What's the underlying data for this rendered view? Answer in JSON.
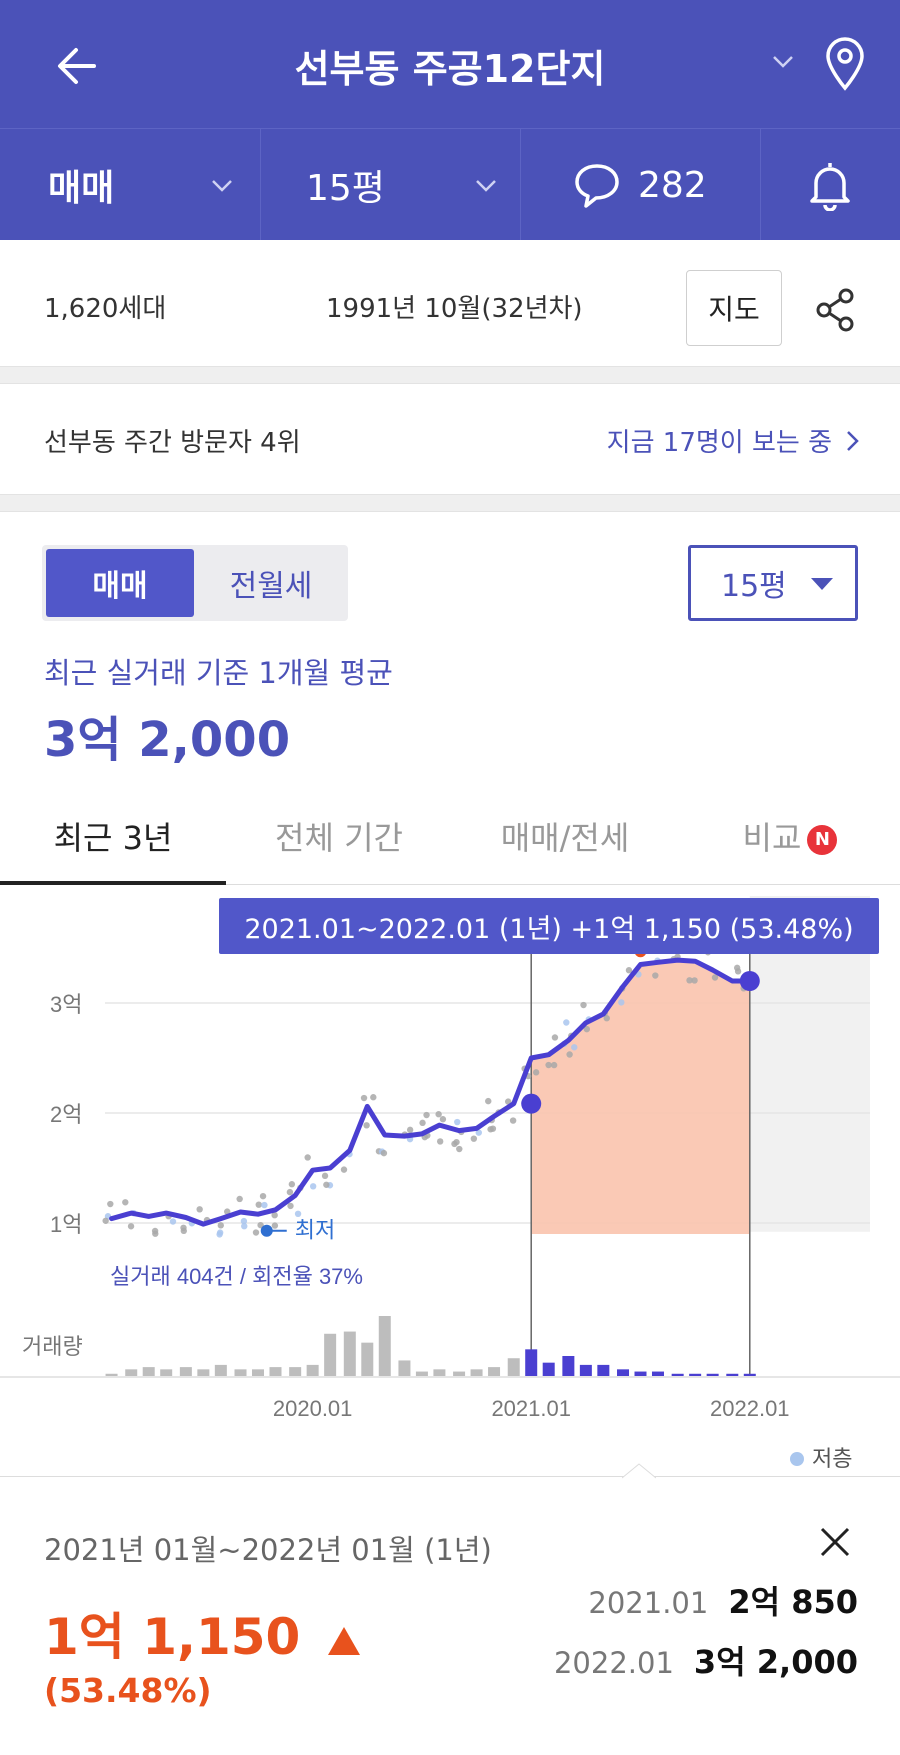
{
  "header": {
    "title": "선부동 주공12단지"
  },
  "subbar": {
    "trade_type": "매매",
    "size": "15평",
    "comment_count": "282"
  },
  "info": {
    "households": "1,620세대",
    "built": "1991년 10월(32년차)",
    "map_label": "지도"
  },
  "rank": {
    "left_text": "선부동 주간 방문자 4위",
    "right_text": "지금 17명이 보는 중"
  },
  "filter": {
    "segment_on": "매매",
    "segment_off": "전월세",
    "size": "15평"
  },
  "summary": {
    "label": "최근 실거래 기준 1개월 평균",
    "price": "3억 2,000"
  },
  "tabs": [
    {
      "label": "최근 3년"
    },
    {
      "label": "전체 기간"
    },
    {
      "label": "매매/전세"
    },
    {
      "label": "비교"
    }
  ],
  "tab_badge": "N",
  "colors": {
    "brand": "#4b52b8",
    "accent_line": "#4a3fd1",
    "highlight_fill": "#f9c3ad",
    "up_red": "#e8521d"
  },
  "chart_data": {
    "type": "line",
    "tooltip": "2021.01~2022.01 (1년)  +1억 1,150 (53.48%)",
    "ytick_labels": [
      "3억",
      "2억",
      "1억"
    ],
    "yticks": [
      3.0,
      2.0,
      1.0
    ],
    "ylim": [
      0.7,
      3.7
    ],
    "xtick_labels": [
      "2020.01",
      "2021.01",
      "2022.01"
    ],
    "xticks": [
      2020.0,
      2021.0,
      2022.0
    ],
    "xlim": [
      2019.05,
      2022.55
    ],
    "volume_label": "거래량",
    "stats": "실거래 404건 / 회전율 37%",
    "min_label": "최저",
    "min_point": {
      "x": 2019.79,
      "y": 0.93
    },
    "legend_low_floor": "저층",
    "selection": {
      "start": 2021.0,
      "end": 2022.0,
      "start_value": 2.085,
      "end_value": 3.2,
      "peak": {
        "x": 2021.5,
        "y": 3.47
      }
    },
    "series": [
      {
        "x": [
          2019.08,
          2019.17,
          2019.25,
          2019.33,
          2019.42,
          2019.5,
          2019.58,
          2019.67,
          2019.75,
          2019.83,
          2019.92,
          2020.0,
          2020.08,
          2020.17,
          2020.25,
          2020.33,
          2020.42,
          2020.5,
          2020.58,
          2020.67,
          2020.75,
          2020.83,
          2020.92,
          2021.0,
          2021.08,
          2021.17,
          2021.25,
          2021.33,
          2021.42,
          2021.5,
          2021.58,
          2021.67,
          2021.75,
          2021.83,
          2021.92,
          2022.0
        ],
        "values": [
          1.04,
          1.09,
          1.06,
          1.09,
          1.05,
          0.99,
          1.04,
          1.1,
          1.08,
          1.12,
          1.25,
          1.48,
          1.5,
          1.66,
          2.06,
          1.8,
          1.79,
          1.81,
          1.89,
          1.84,
          1.86,
          1.97,
          2.085,
          2.5,
          2.53,
          2.66,
          2.82,
          2.9,
          3.15,
          3.35,
          3.37,
          3.39,
          3.38,
          3.3,
          3.2,
          3.2
        ]
      }
    ],
    "volume": {
      "x": [
        2019.08,
        2019.17,
        2019.25,
        2019.33,
        2019.42,
        2019.5,
        2019.58,
        2019.67,
        2019.75,
        2019.83,
        2019.92,
        2020.0,
        2020.08,
        2020.17,
        2020.25,
        2020.33,
        2020.42,
        2020.5,
        2020.58,
        2020.67,
        2020.75,
        2020.83,
        2020.92,
        2021.0,
        2021.08,
        2021.17,
        2021.25,
        2021.33,
        2021.42,
        2021.5,
        2021.58,
        2021.67,
        2021.75,
        2021.83,
        2021.92,
        2022.0
      ],
      "values": [
        2,
        6,
        8,
        6,
        8,
        6,
        10,
        6,
        6,
        8,
        8,
        10,
        38,
        40,
        30,
        54,
        14,
        4,
        6,
        4,
        6,
        8,
        16,
        24,
        12,
        18,
        10,
        10,
        6,
        4,
        4,
        2,
        2,
        2,
        2,
        2
      ]
    }
  },
  "selection_panel": {
    "range": "2021년 01월~2022년 01월 (1년)",
    "change": "1억 1,150",
    "pct": "(53.48%)",
    "from_date": "2021.01",
    "from_value": "2억 850",
    "to_date": "2022.01",
    "to_value": "3억 2,000"
  }
}
